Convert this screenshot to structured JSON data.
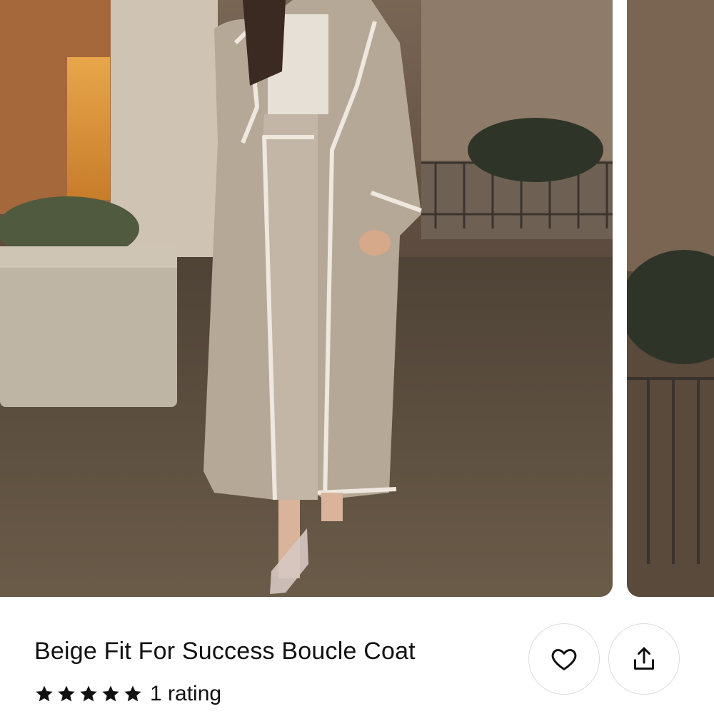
{
  "product": {
    "title": "Beige Fit For Success Boucle Coat",
    "rating_stars": 5,
    "rating_text": "1 rating"
  },
  "carousel": {
    "images": [
      {
        "alt": "Model wearing beige boucle coat with cream trim at night"
      },
      {
        "alt": "Next product image preview"
      }
    ]
  },
  "actions": {
    "favorite_icon": "heart-outline-icon",
    "share_icon": "share-upload-icon"
  },
  "colors": {
    "text": "#111111",
    "button_border": "#dcdcdc",
    "coat": "#b6a897",
    "trim": "#eee8df"
  }
}
